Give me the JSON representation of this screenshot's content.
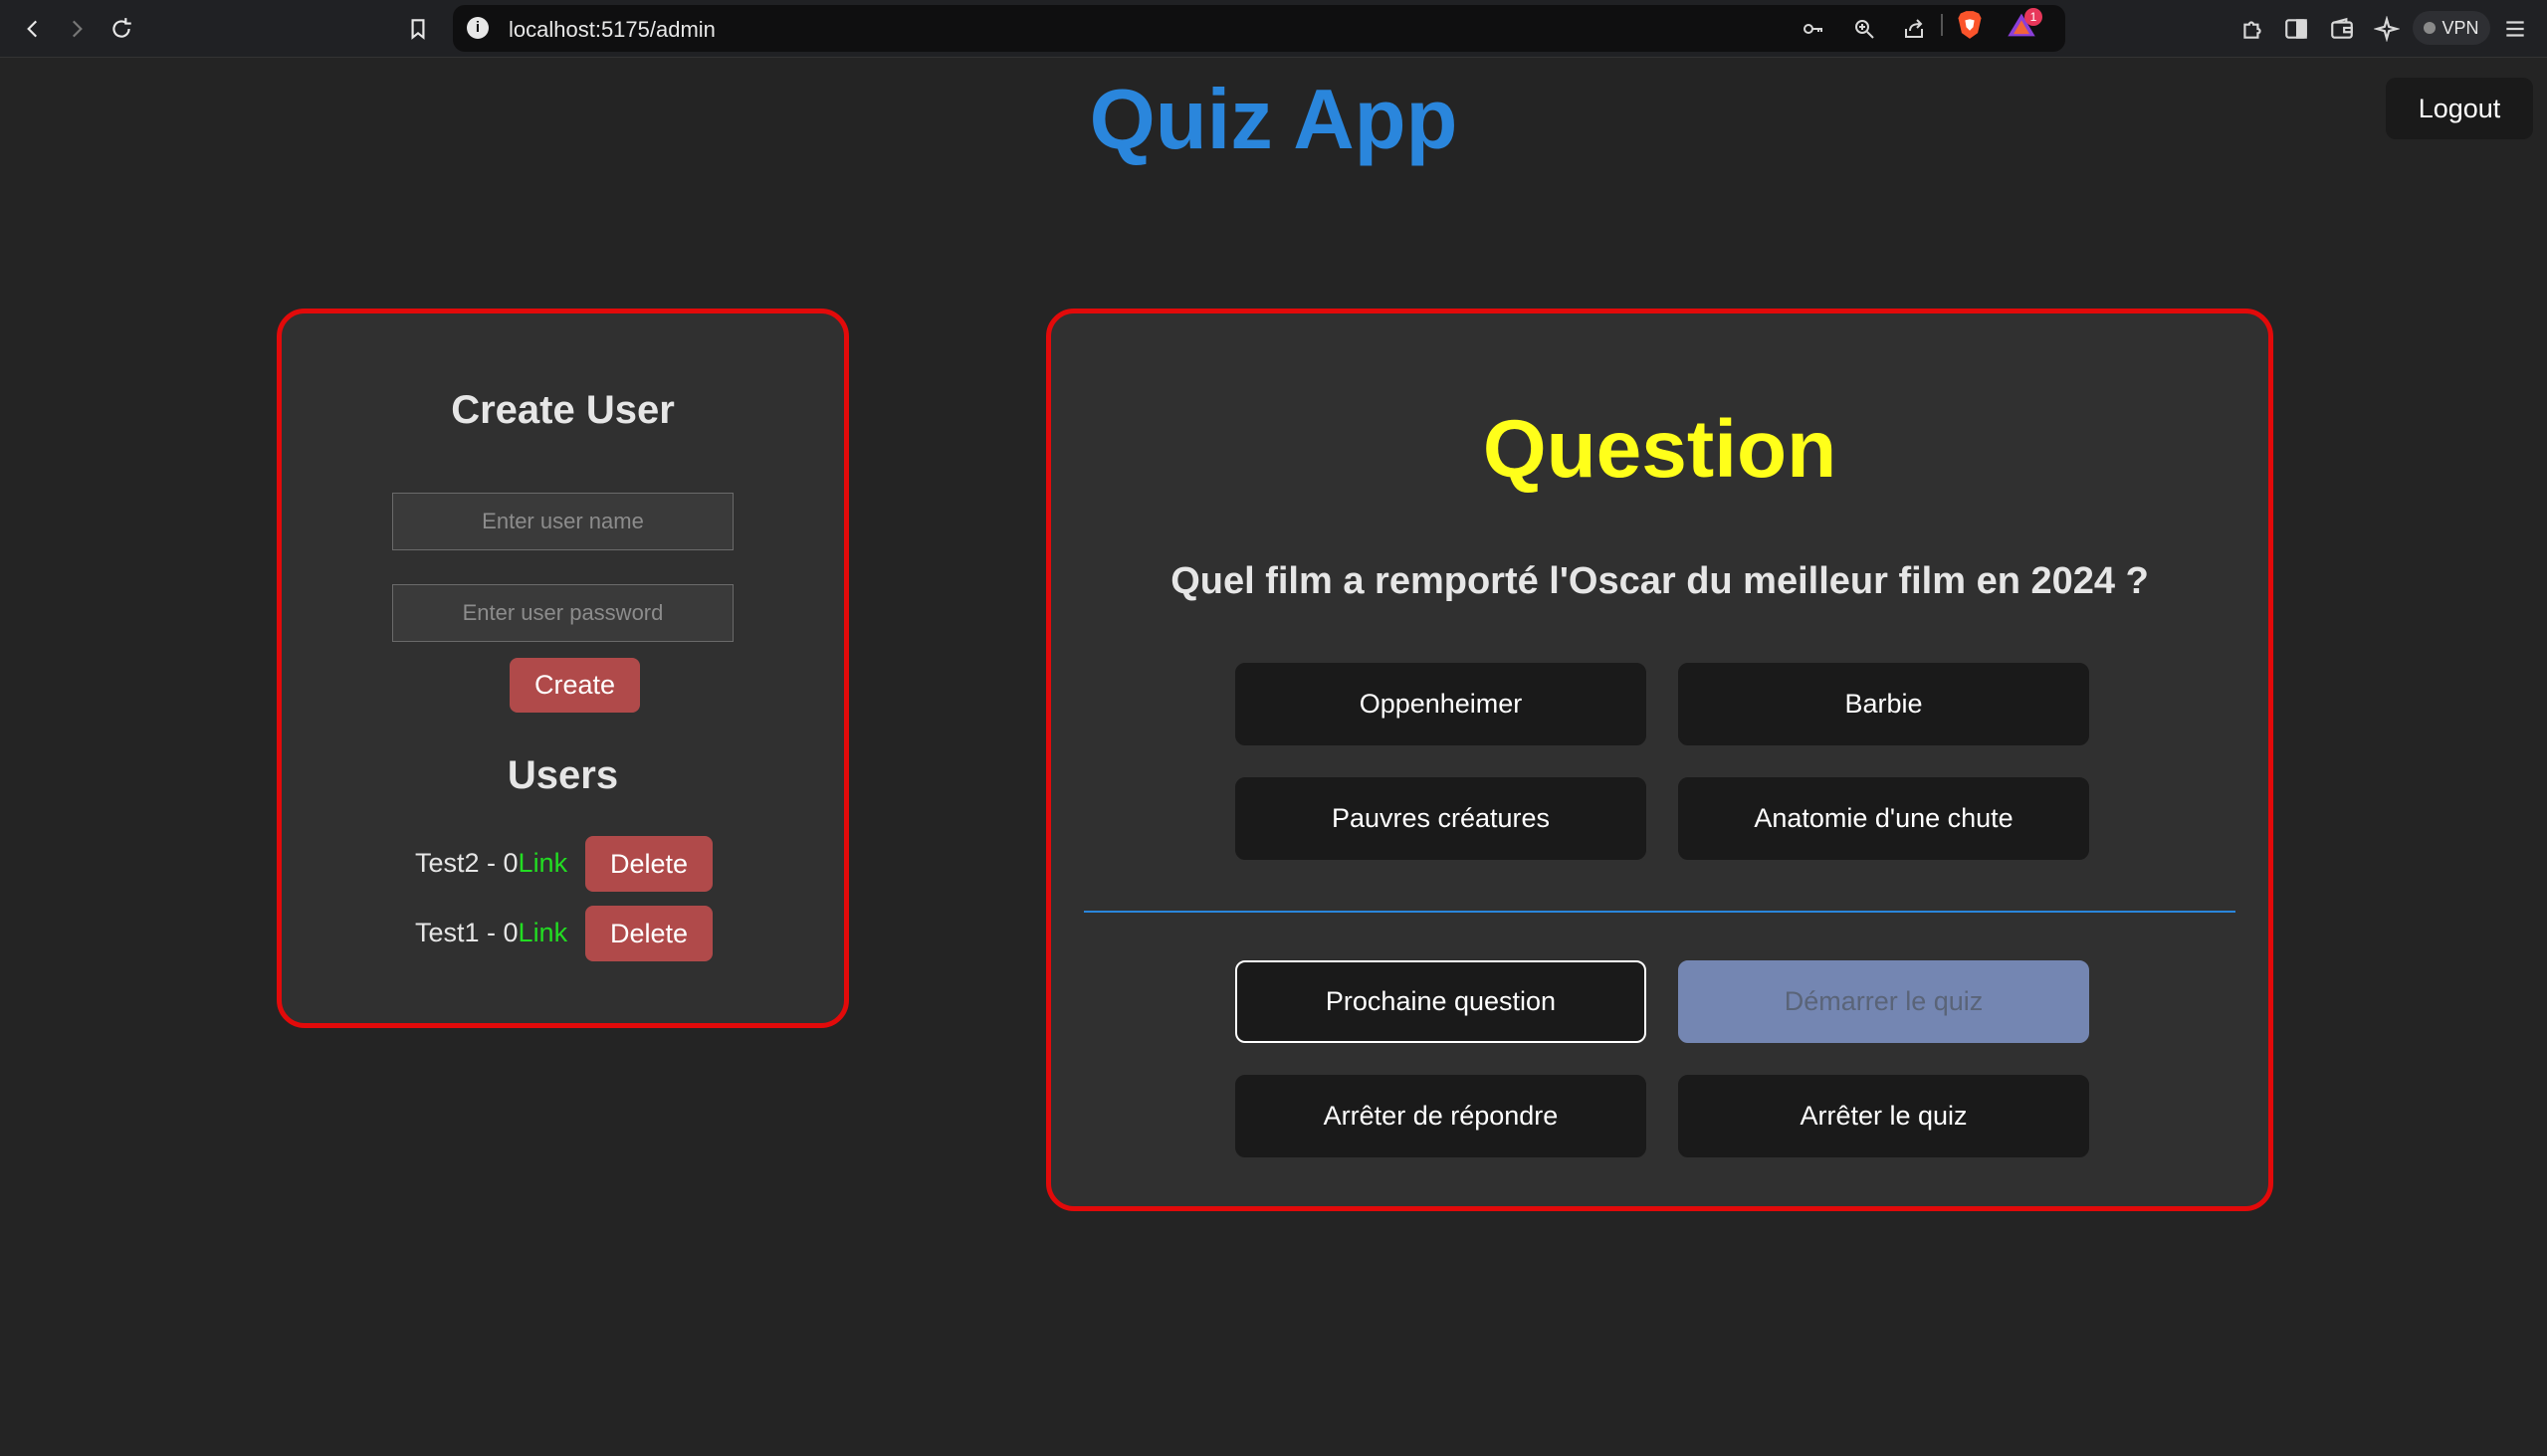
{
  "browser": {
    "url": "localhost:5175/admin",
    "vpn_label": "VPN",
    "rewards_badge": "1"
  },
  "app": {
    "title": "Quiz App",
    "logout_label": "Logout"
  },
  "create_user": {
    "heading": "Create User",
    "name_placeholder": "Enter user name",
    "password_placeholder": "Enter user password",
    "create_label": "Create"
  },
  "users": {
    "heading": "Users",
    "delete_label": "Delete",
    "link_label": "Link",
    "items": [
      {
        "label": "Test2 - 0"
      },
      {
        "label": "Test1 - 0"
      }
    ]
  },
  "question": {
    "heading": "Question",
    "text": "Quel film a remporté l'Oscar du meilleur film en 2024 ?",
    "answers": [
      "Oppenheimer",
      "Barbie",
      "Pauvres créatures",
      "Anatomie d'une chute"
    ],
    "controls": {
      "next": "Prochaine question",
      "start": "Démarrer le quiz",
      "stop_answering": "Arrêter de répondre",
      "stop_quiz": "Arrêter le quiz"
    }
  },
  "colors": {
    "title": "#2a86dc",
    "panel_border": "#e20a0a",
    "question_heading": "#ffff1a",
    "link": "#22dd22",
    "danger_button": "#b04a4a",
    "disabled_button": "#7486b2"
  },
  "icons": [
    "back-arrow-icon",
    "forward-arrow-icon",
    "reload-icon",
    "bookmark-icon",
    "site-info-icon",
    "key-icon",
    "zoom-icon",
    "share-icon",
    "brave-shields-icon",
    "brave-rewards-icon",
    "extensions-icon",
    "sidebar-icon",
    "wallet-icon",
    "leo-ai-icon",
    "menu-icon"
  ]
}
